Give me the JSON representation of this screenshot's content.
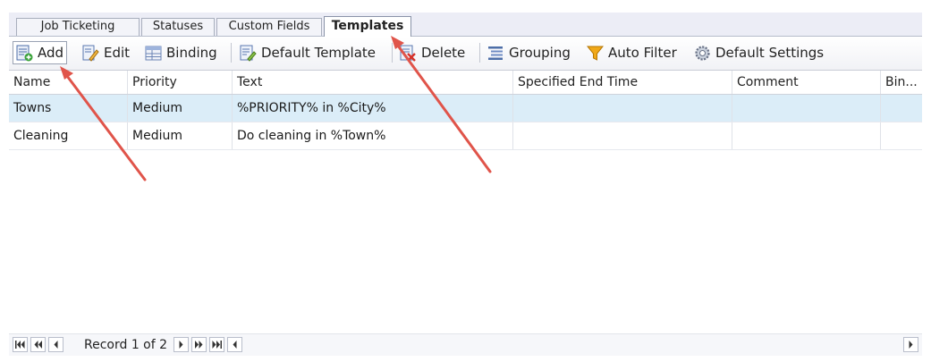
{
  "tabs": [
    {
      "label": "Job Ticketing",
      "active": false
    },
    {
      "label": "Statuses",
      "active": false
    },
    {
      "label": "Custom Fields",
      "active": false
    },
    {
      "label": "Templates",
      "active": true
    }
  ],
  "toolbar": {
    "add_label": "Add",
    "edit_label": "Edit",
    "binding_label": "Binding",
    "default_template_label": "Default Template",
    "delete_label": "Delete",
    "grouping_label": "Grouping",
    "auto_filter_label": "Auto Filter",
    "default_settings_label": "Default Settings"
  },
  "grid": {
    "columns": [
      "Name",
      "Priority",
      "Text",
      "Specified End Time",
      "Comment",
      "Bin..."
    ],
    "rows": [
      {
        "name": "Towns",
        "priority": "Medium",
        "text": "%PRIORITY% in %City%",
        "end_time": "",
        "comment": "",
        "binding": "",
        "selected": true
      },
      {
        "name": "Cleaning",
        "priority": "Medium",
        "text": "Do cleaning in %Town%",
        "end_time": "",
        "comment": "",
        "binding": "",
        "selected": false
      }
    ]
  },
  "navigator": {
    "record_text": "Record 1 of 2"
  },
  "icons": {
    "add": "add-record-icon",
    "edit": "edit-pencil-icon",
    "binding": "binding-icon",
    "default_template": "default-template-icon",
    "delete": "delete-icon",
    "grouping": "grouping-icon",
    "auto_filter": "funnel-filter-icon",
    "default_settings": "gear-settings-icon"
  },
  "colors": {
    "selected_row": "#dbedf8",
    "annotation_arrow": "#e0544a",
    "filter_icon": "#f0a818"
  }
}
